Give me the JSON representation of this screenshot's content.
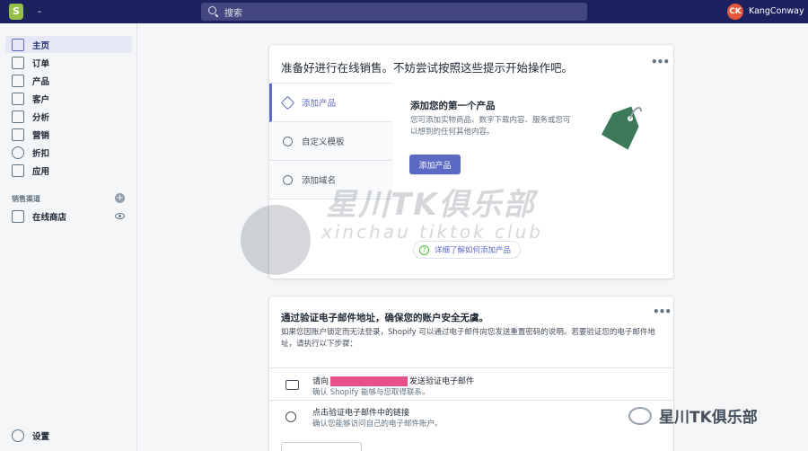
{
  "topbar": {
    "store_name": "-",
    "search_placeholder": "搜索",
    "user_initials": "CK",
    "user_name": "KangConway"
  },
  "sidebar": {
    "items": [
      {
        "label": "主页",
        "icon": "home-icon"
      },
      {
        "label": "订单",
        "icon": "orders-icon"
      },
      {
        "label": "产品",
        "icon": "tag-icon"
      },
      {
        "label": "客户",
        "icon": "customer-icon"
      },
      {
        "label": "分析",
        "icon": "analytics-icon"
      },
      {
        "label": "营销",
        "icon": "megaphone-icon"
      },
      {
        "label": "折扣",
        "icon": "discount-icon"
      },
      {
        "label": "应用",
        "icon": "apps-icon"
      }
    ],
    "section_title": "销售渠道",
    "channel": {
      "label": "在线商店"
    },
    "settings_label": "设置"
  },
  "setup_card": {
    "title": "准备好进行在线销售。不妨尝试按照这些提示开始操作吧。",
    "tabs": [
      {
        "label": "添加产品"
      },
      {
        "label": "自定义模板"
      },
      {
        "label": "添加域名"
      }
    ],
    "panel_title": "添加您的第一个产品",
    "panel_desc": "您可添加实物商品、数字下载内容、服务或您可以想到的任何其他内容。",
    "primary_button": "添加产品",
    "learn_link": "详细了解如何添加产品"
  },
  "verify_card": {
    "title": "通过验证电子邮件地址，确保您的账户安全无虞。",
    "desc": "如果您因账户锁定而无法登录，Shopify 可以通过电子邮件向您发送重置密码的说明。若要验证您的电子邮件地址，请执行以下步骤：",
    "step1_prefix": "请向",
    "step1_suffix": "发送验证电子邮件",
    "step1_sub": "确认 Shopify 能够与您取得联系。",
    "step2_title": "点击验证电子邮件中的链接",
    "step2_sub": "确认您能够访问自己的电子邮件账户。"
  },
  "watermark": {
    "main": "星川TK俱乐部",
    "sub": "xinchau tiktok club",
    "wechat": "星川TK俱乐部"
  },
  "colors": {
    "topbar": "#1c2260",
    "accent": "#5c6ac4",
    "tag_green": "#3c7a5a",
    "redaction": "#e8508a"
  }
}
